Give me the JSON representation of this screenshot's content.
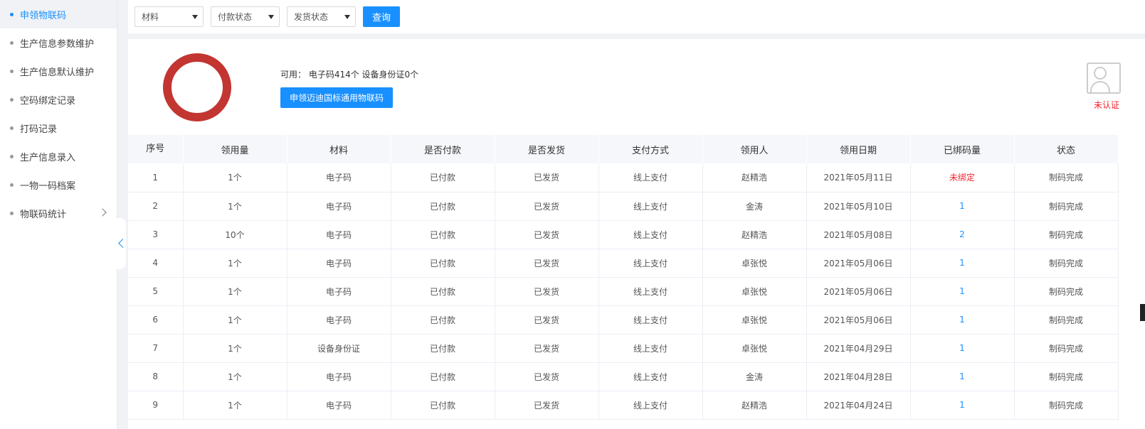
{
  "sidebar": {
    "items": [
      {
        "label": "申领物联码",
        "active": true
      },
      {
        "label": "生产信息参数维护"
      },
      {
        "label": "生产信息默认维护"
      },
      {
        "label": "空码绑定记录"
      },
      {
        "label": "打码记录"
      },
      {
        "label": "生产信息录入"
      },
      {
        "label": "一物一码档案"
      },
      {
        "label": "物联码统计",
        "has_children": true
      }
    ]
  },
  "filters": {
    "material": "材料",
    "payment_status": "付款状态",
    "shipping_status": "发货状态",
    "query_label": "查询"
  },
  "stats": {
    "available_text": "可用： 电子码414个 设备身份证0个",
    "apply_label": "申领迈迪国标通用物联码",
    "cert_status": "未认证",
    "ring_color": "#c23531"
  },
  "table": {
    "headers": [
      "序号",
      "领用量",
      "材料",
      "是否付款",
      "是否发货",
      "支付方式",
      "领用人",
      "领用日期",
      "已绑码量",
      "状态"
    ],
    "rows": [
      [
        "1",
        "1个",
        "电子码",
        "已付款",
        "已发货",
        "线上支付",
        "赵精浩",
        "2021年05月11日",
        "未绑定",
        "制码完成"
      ],
      [
        "2",
        "1个",
        "电子码",
        "已付款",
        "已发货",
        "线上支付",
        "金涛",
        "2021年05月10日",
        "1",
        "制码完成"
      ],
      [
        "3",
        "10个",
        "电子码",
        "已付款",
        "已发货",
        "线上支付",
        "赵精浩",
        "2021年05月08日",
        "2",
        "制码完成"
      ],
      [
        "4",
        "1个",
        "电子码",
        "已付款",
        "已发货",
        "线上支付",
        "卓张悦",
        "2021年05月06日",
        "1",
        "制码完成"
      ],
      [
        "5",
        "1个",
        "电子码",
        "已付款",
        "已发货",
        "线上支付",
        "卓张悦",
        "2021年05月06日",
        "1",
        "制码完成"
      ],
      [
        "6",
        "1个",
        "电子码",
        "已付款",
        "已发货",
        "线上支付",
        "卓张悦",
        "2021年05月06日",
        "1",
        "制码完成"
      ],
      [
        "7",
        "1个",
        "设备身份证",
        "已付款",
        "已发货",
        "线上支付",
        "卓张悦",
        "2021年04月29日",
        "1",
        "制码完成"
      ],
      [
        "8",
        "1个",
        "电子码",
        "已付款",
        "已发货",
        "线上支付",
        "金涛",
        "2021年04月28日",
        "1",
        "制码完成"
      ],
      [
        "9",
        "1个",
        "电子码",
        "已付款",
        "已发货",
        "线上支付",
        "赵精浩",
        "2021年04月24日",
        "1",
        "制码完成"
      ]
    ]
  }
}
